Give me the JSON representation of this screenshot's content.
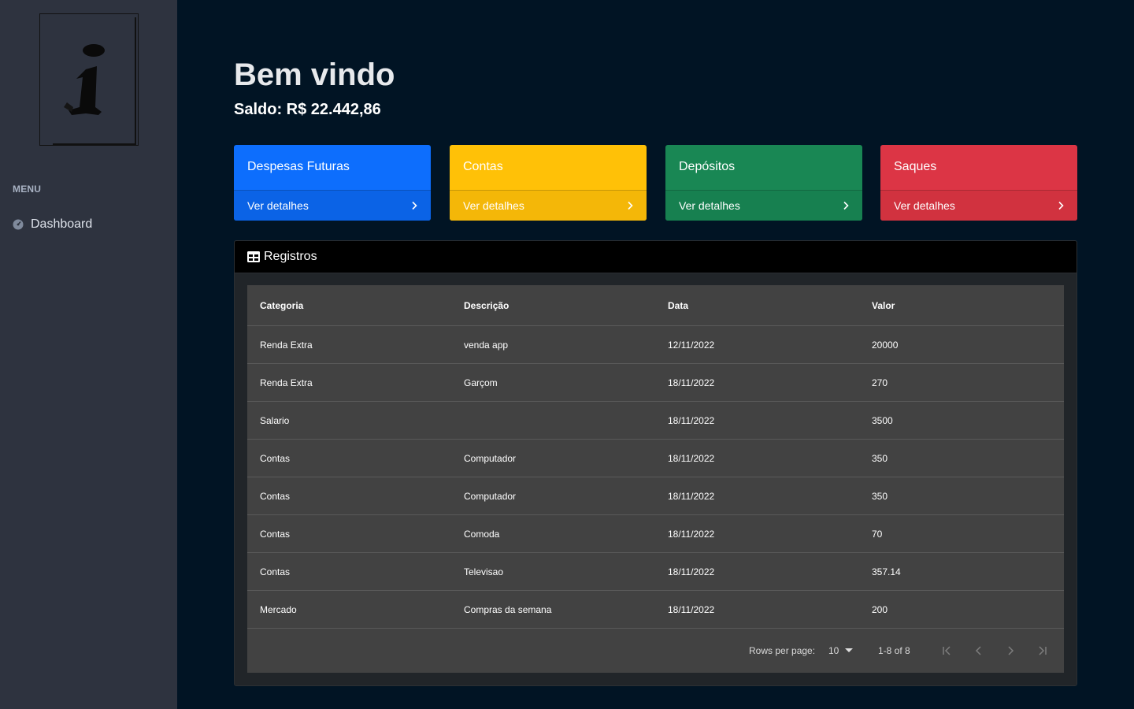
{
  "sidebar": {
    "menu_heading": "MENU",
    "items": [
      {
        "label": "Dashboard",
        "icon": "dashboard-icon"
      }
    ]
  },
  "header": {
    "title": "Bem vindo",
    "balance": "Saldo: R$ 22.442,86"
  },
  "cards": [
    {
      "title": "Despesas Futuras",
      "link": "Ver detalhes",
      "color": "#0d6efd",
      "footer_color": "#0b63e6"
    },
    {
      "title": "Contas",
      "link": "Ver detalhes",
      "color": "#ffc107",
      "footer_color": "#f4b708"
    },
    {
      "title": "Depósitos",
      "link": "Ver detalhes",
      "color": "#198754",
      "footer_color": "#178050"
    },
    {
      "title": "Saques",
      "link": "Ver detalhes",
      "color": "#dc3545",
      "footer_color": "#d1323f"
    }
  ],
  "registros": {
    "title": "Registros",
    "columns": [
      "Categoria",
      "Descrição",
      "Data",
      "Valor"
    ],
    "rows": [
      [
        "Renda Extra",
        "venda app",
        "12/11/2022",
        "20000"
      ],
      [
        "Renda Extra",
        "Garçom",
        "18/11/2022",
        "270"
      ],
      [
        "Salario",
        "",
        "18/11/2022",
        "3500"
      ],
      [
        "Contas",
        "Computador",
        "18/11/2022",
        "350"
      ],
      [
        "Contas",
        "Computador",
        "18/11/2022",
        "350"
      ],
      [
        "Contas",
        "Comoda",
        "18/11/2022",
        "70"
      ],
      [
        "Contas",
        "Televisao",
        "18/11/2022",
        "357.14"
      ],
      [
        "Mercado",
        "Compras da semana",
        "18/11/2022",
        "200"
      ]
    ],
    "pagination": {
      "rows_per_page_label": "Rows per page:",
      "rows_per_page": "10",
      "range": "1-8 of 8"
    }
  }
}
